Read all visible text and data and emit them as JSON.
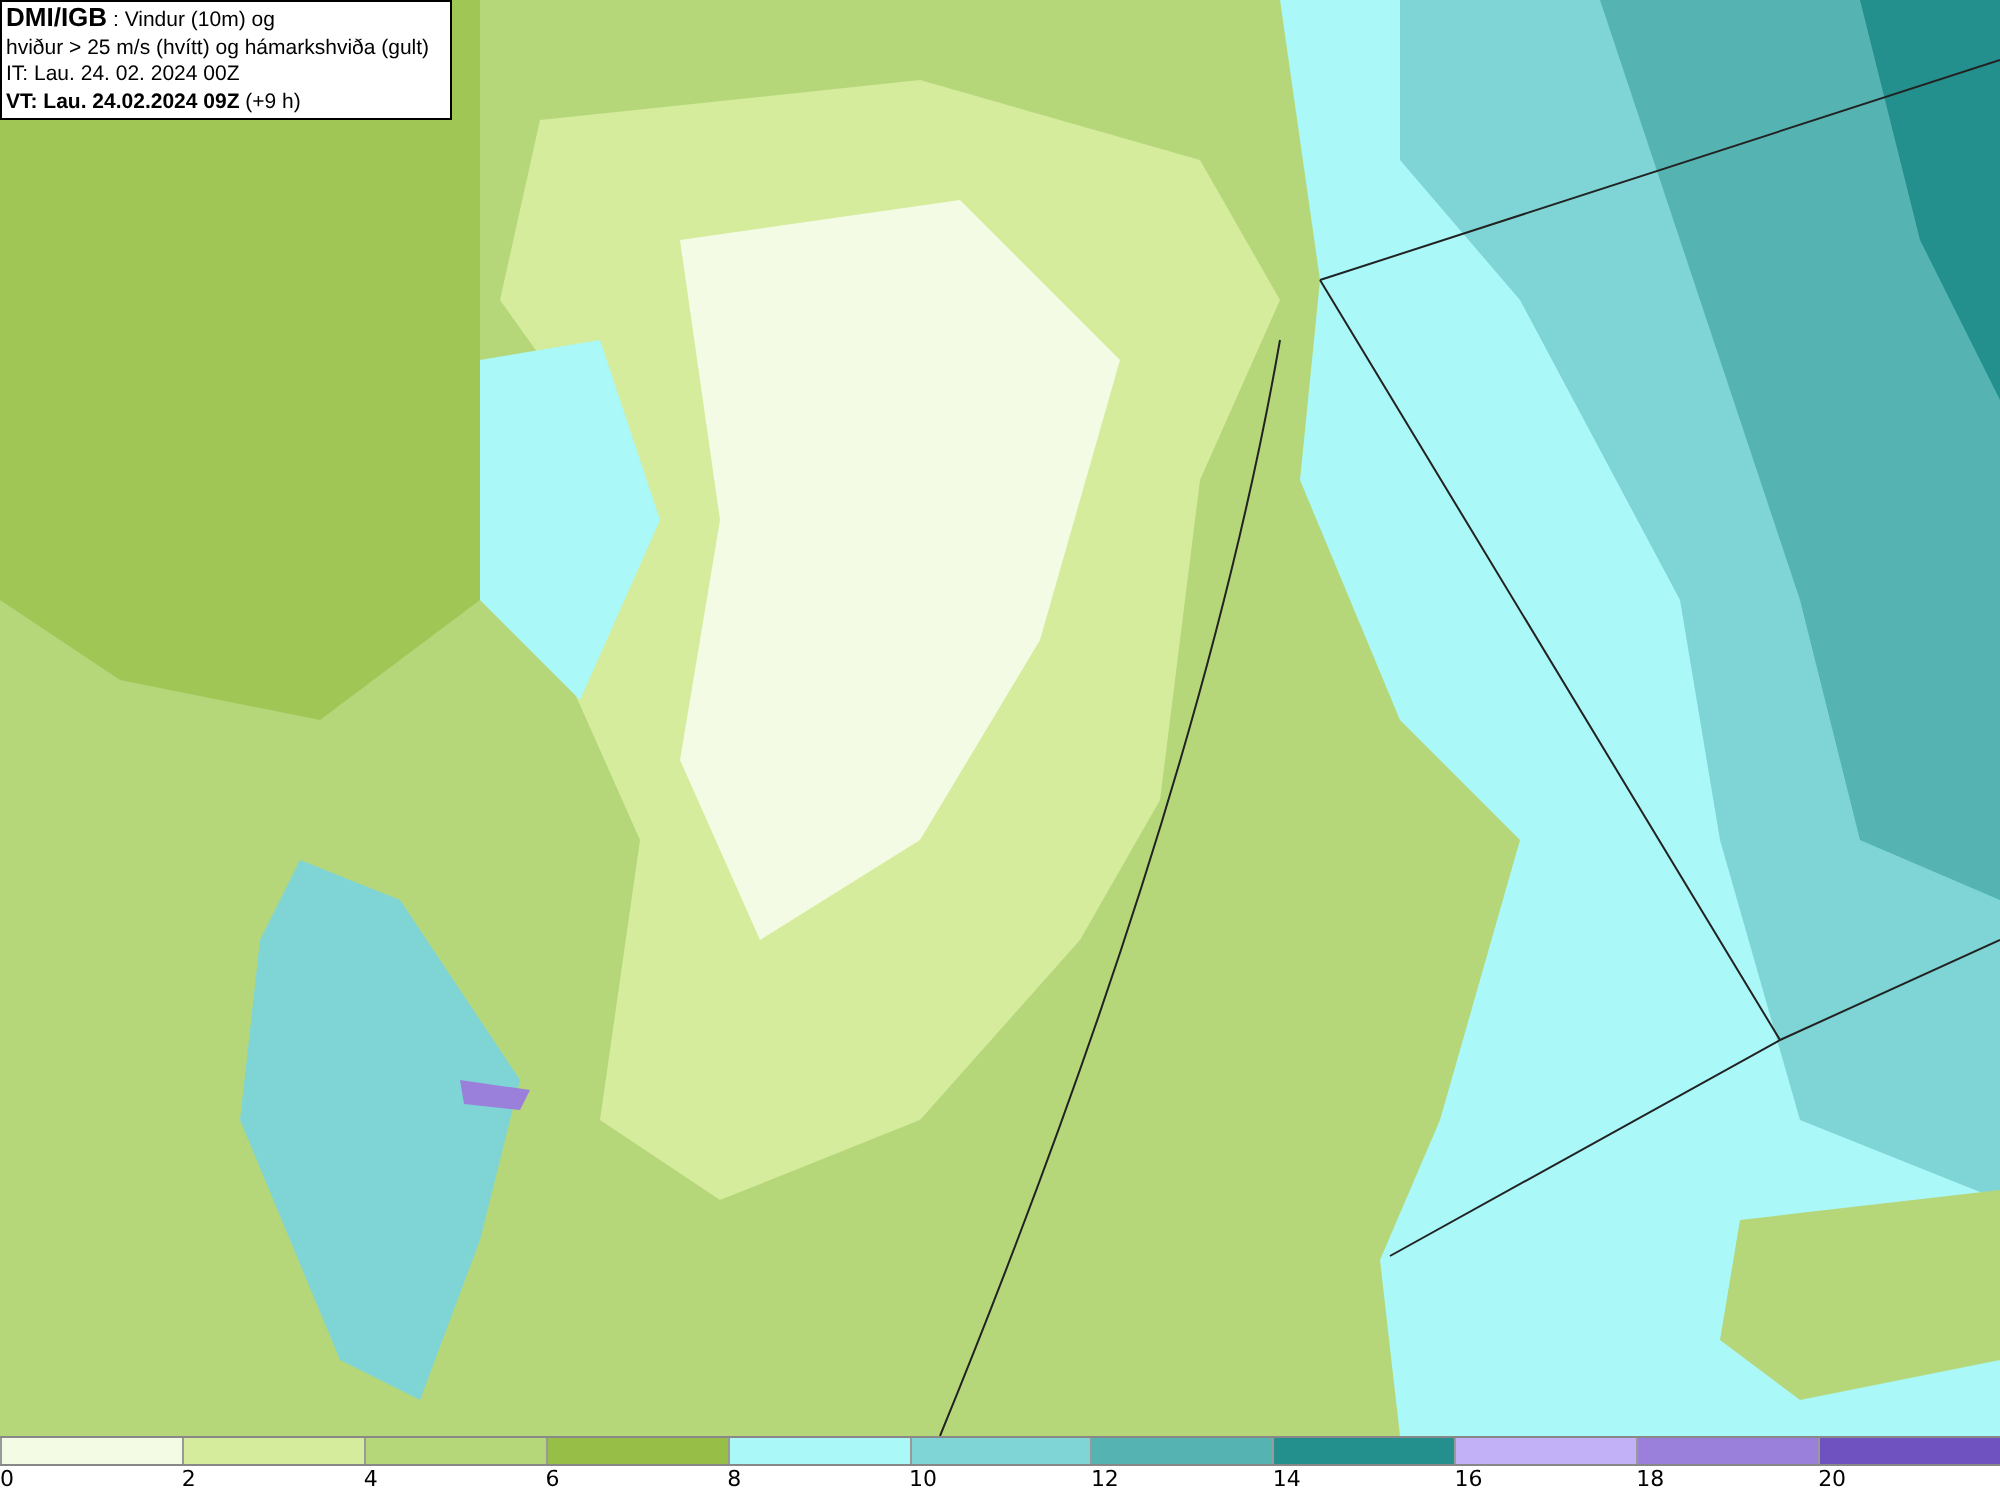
{
  "header": {
    "lines": [
      "**DMI/IGB** : Vindur (10m) og",
      "hviður > 25 m/s (hvítt) og hámarkshviða (gult)",
      "IT: Lau. 24. 02. 2024 00Z",
      "**VT: Lau. 24.02.2024 09Z** (+9 h)"
    ]
  },
  "legend": [
    {
      "label": "0",
      "color": "#f4fbe4"
    },
    {
      "label": "2",
      "color": "#d4ec9c"
    },
    {
      "label": "4",
      "color": "#b5d77a"
    },
    {
      "label": "6",
      "color": "#97bf47"
    },
    {
      "label": "8",
      "color": "#aaf8f8"
    },
    {
      "label": "10",
      "color": "#7fd5d6"
    },
    {
      "label": "12",
      "color": "#55b3b2"
    },
    {
      "label": "14",
      "color": "#24908e"
    },
    {
      "label": "16",
      "color": "#c3b1f7"
    },
    {
      "label": "18",
      "color": "#9a80db"
    },
    {
      "label": "20",
      "color": "#6f52bf"
    }
  ]
}
